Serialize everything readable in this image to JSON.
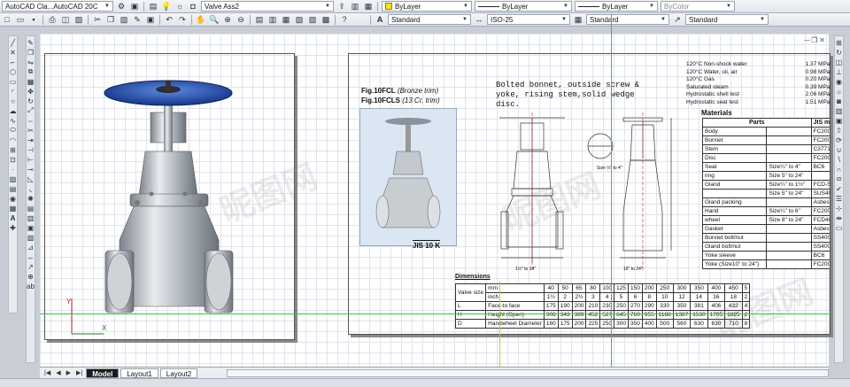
{
  "toolbar1": {
    "workspace": "AutoCAD Cla...AutoCAD 20C",
    "layer": "Valve Ass2",
    "color": "ByLayer",
    "linetype": "ByLayer",
    "lineweight": "ByLayer",
    "plotstyle": "ByColor"
  },
  "toolbar2": {
    "text_style": "Standard",
    "dim_style": "ISO-25",
    "table_style": "Standard",
    "multileader_style": "Standard"
  },
  "drawing": {
    "fig_title1": "Fig.10FCL",
    "fig_title1_note": "(Bronze trim)",
    "fig_title2": "Fig.10FCLS",
    "fig_title2_note": "(13 Cr. trim)",
    "description": "Bolted bonnet, outside screw & yoke, rising stem,solid wedge disc.",
    "jis_label": "JIS 10 K",
    "pressure_rows": [
      {
        "label": "120°C Non-shock water",
        "value": "1.37 MPa (1"
      },
      {
        "label": "120°C Water, oil, air",
        "value": "0.98 MPa (1"
      },
      {
        "label": "120°C Gas",
        "value": "0.20 MPa (2"
      },
      {
        "label": "Saturated steam",
        "value": "0.39 MPa (2"
      },
      {
        "label": "Hydrostatic shell test",
        "value": "2.06 MPa (2"
      },
      {
        "label": "Hydrostatic seat test",
        "value": "1.51 MPa (1"
      }
    ],
    "materials_title": "Materials",
    "parts_header": "Parts",
    "jis_mat_header": "JIS mat",
    "parts": [
      {
        "name": "Body",
        "size": "",
        "mat": "FC200"
      },
      {
        "name": "Bonnet",
        "size": "",
        "mat": "FC200"
      },
      {
        "name": "Stem",
        "size": "",
        "mat": "C3771BD"
      },
      {
        "name": "Disc",
        "size": "",
        "mat": "FC200"
      },
      {
        "name": "Seat",
        "size": "Size¼\" to 4\"",
        "mat": "BC6"
      },
      {
        "name": "ring",
        "size": "Size 5\" to 24\"",
        "mat": ""
      },
      {
        "name": "Gland",
        "size": "Size¼\" to 1½\"",
        "mat": "FCD-S"
      },
      {
        "name": "",
        "size": "Size 5\" to 24\"",
        "mat": "SUS403"
      },
      {
        "name": "Gland packing",
        "size": "",
        "mat": "Asbestos"
      },
      {
        "name": "Hand",
        "size": "Size¼\" to 6\"",
        "mat": "FC200"
      },
      {
        "name": "wheel",
        "size": "Size 8\" to 24\"",
        "mat": "FCD400"
      },
      {
        "name": "Gasket",
        "size": "",
        "mat": "Asbestos"
      },
      {
        "name": "Bonnet bolt/nut",
        "size": "",
        "mat": "SS400"
      },
      {
        "name": "Gland bolt/nut",
        "size": "",
        "mat": "SS400"
      },
      {
        "name": "Yoke sleeve",
        "size": "",
        "mat": "BC6"
      },
      {
        "name": "Yoke (Size10\" to 24\")",
        "size": "",
        "mat": "FC200"
      }
    ],
    "dimensions_title": "Dimensions",
    "valve_size_label": "Valve size",
    "mm_label": "mm",
    "inch_label": "inch",
    "mm_values": [
      "40",
      "50",
      "65",
      "80",
      "100",
      "125",
      "150",
      "200",
      "250",
      "300",
      "350",
      "400",
      "450",
      "5"
    ],
    "inch_values": [
      "1½",
      "2",
      "2½",
      "3",
      "4",
      "5",
      "6",
      "8",
      "10",
      "12",
      "14",
      "16",
      "18",
      "2"
    ],
    "dim_rows": [
      {
        "code": "L",
        "name": "Face-to face",
        "values": [
          "175",
          "190",
          "200",
          "210",
          "230",
          "250",
          "270",
          "290",
          "330",
          "350",
          "381",
          "406",
          "432",
          "4"
        ]
      },
      {
        "code": "H",
        "name": "Height (Open)",
        "values": [
          "308",
          "343",
          "389",
          "452",
          "527",
          "645",
          "760",
          "955",
          "1188",
          "1387",
          "1530",
          "1705",
          "1825",
          "2"
        ]
      },
      {
        "code": "D",
        "name": "Handwheel Diameter",
        "values": [
          "160",
          "175",
          "200",
          "225",
          "250",
          "300",
          "350",
          "400",
          "500",
          "560",
          "630",
          "630",
          "710",
          "8"
        ]
      }
    ],
    "dim_small_labels": [
      "1½\" to 14\"",
      "16\" to 24\"",
      "Size ½\" to 4\""
    ]
  },
  "layout_tabs": [
    "Model",
    "Layout1",
    "Layout2"
  ],
  "watermark": "昵图网",
  "colors": {
    "handwheel": "#1d4fae",
    "canvas": "#ffffff",
    "grid": "#dfe4ec",
    "crosshair": "#32c832"
  }
}
